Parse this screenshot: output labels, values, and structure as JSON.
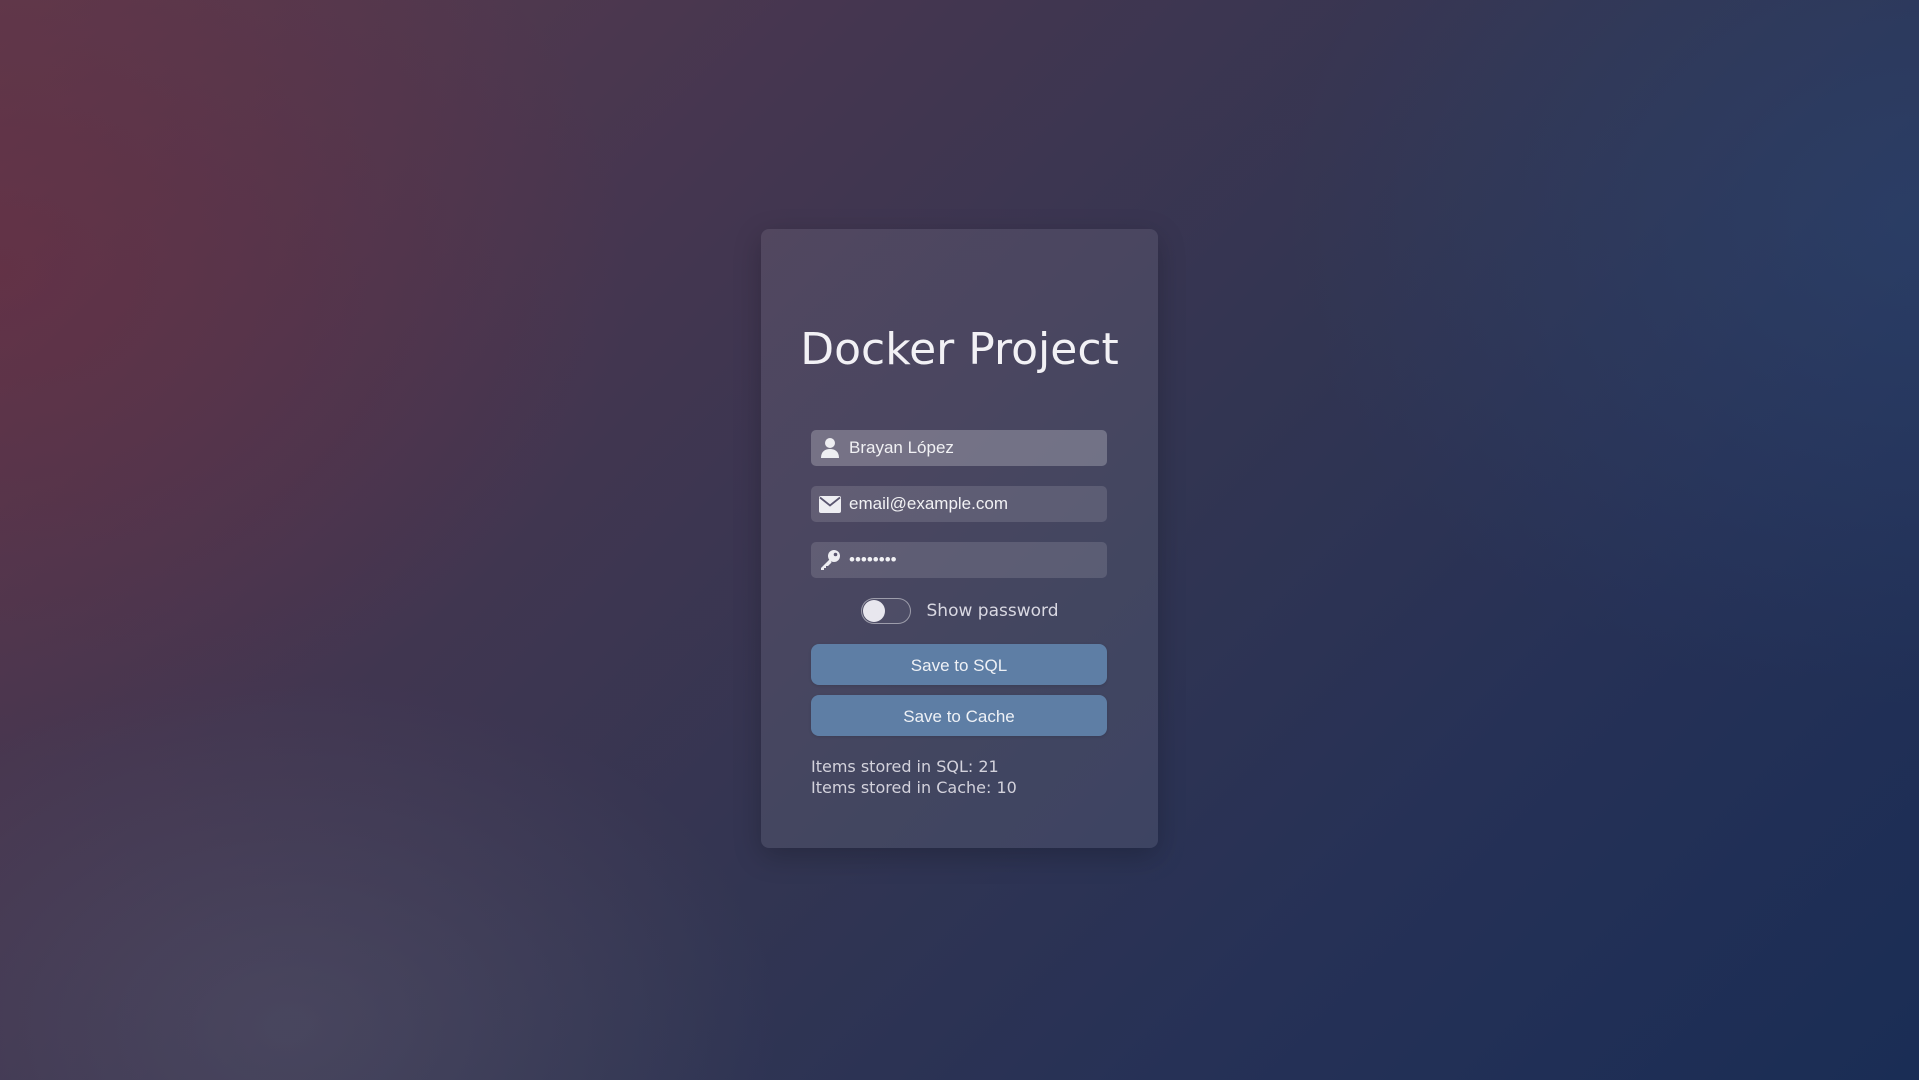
{
  "app": {
    "title": "Docker Project"
  },
  "form": {
    "name": {
      "value": "Brayan López",
      "icon": "user-icon"
    },
    "email": {
      "value": "email@example.com",
      "icon": "envelope-icon"
    },
    "password": {
      "value": "••••••••",
      "icon": "key-icon"
    },
    "show_password": {
      "label": "Show password",
      "checked": false
    }
  },
  "buttons": {
    "save_sql": "Save to SQL",
    "save_cache": "Save to Cache"
  },
  "stats": {
    "sql": "Items stored in SQL: 21",
    "cache": "Items stored in Cache: 10"
  },
  "colors": {
    "button": "#5e7ea5",
    "text": "#f2f1f5"
  }
}
